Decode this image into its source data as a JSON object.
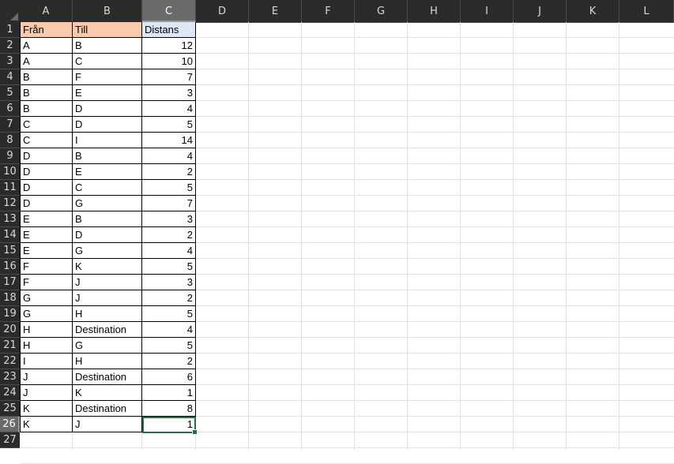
{
  "columns": [
    "A",
    "B",
    "C",
    "D",
    "E",
    "F",
    "G",
    "H",
    "I",
    "J",
    "K",
    "L"
  ],
  "selected_column": "C",
  "selected_row": 26,
  "row_numbers": [
    1,
    2,
    3,
    4,
    5,
    6,
    7,
    8,
    9,
    10,
    11,
    12,
    13,
    14,
    15,
    16,
    17,
    18,
    19,
    20,
    21,
    22,
    23,
    24,
    25,
    26,
    27
  ],
  "headers": {
    "a": "Från",
    "b": "Till",
    "c": "Distans"
  },
  "rows": [
    {
      "a": "A",
      "b": "B",
      "c": "12"
    },
    {
      "a": "A",
      "b": "C",
      "c": "10"
    },
    {
      "a": "B",
      "b": "F",
      "c": "7"
    },
    {
      "a": "B",
      "b": "E",
      "c": "3"
    },
    {
      "a": "B",
      "b": "D",
      "c": "4"
    },
    {
      "a": "C",
      "b": "D",
      "c": "5"
    },
    {
      "a": "C",
      "b": "I",
      "c": "14"
    },
    {
      "a": "D",
      "b": "B",
      "c": "4"
    },
    {
      "a": "D",
      "b": "E",
      "c": "2"
    },
    {
      "a": "D",
      "b": "C",
      "c": "5"
    },
    {
      "a": "D",
      "b": "G",
      "c": "7"
    },
    {
      "a": "E",
      "b": "B",
      "c": "3"
    },
    {
      "a": "E",
      "b": "D",
      "c": "2"
    },
    {
      "a": "E",
      "b": "G",
      "c": "4"
    },
    {
      "a": "F",
      "b": "K",
      "c": "5"
    },
    {
      "a": "F",
      "b": "J",
      "c": "3"
    },
    {
      "a": "G",
      "b": "J",
      "c": "2"
    },
    {
      "a": "G",
      "b": "H",
      "c": "5"
    },
    {
      "a": "H",
      "b": "Destination",
      "c": "4"
    },
    {
      "a": "H",
      "b": "G",
      "c": "5"
    },
    {
      "a": "I",
      "b": "H",
      "c": "2"
    },
    {
      "a": "J",
      "b": "Destination",
      "c": "6"
    },
    {
      "a": "J",
      "b": "K",
      "c": "1"
    },
    {
      "a": "K",
      "b": "Destination",
      "c": "8"
    },
    {
      "a": "K",
      "b": "J",
      "c": "1"
    }
  ],
  "colors": {
    "header_a_b_fill": "#f8cbad",
    "header_c_fill": "#dde7f5",
    "selection_border": "#217346",
    "chrome_bg": "#2b2b2b"
  }
}
